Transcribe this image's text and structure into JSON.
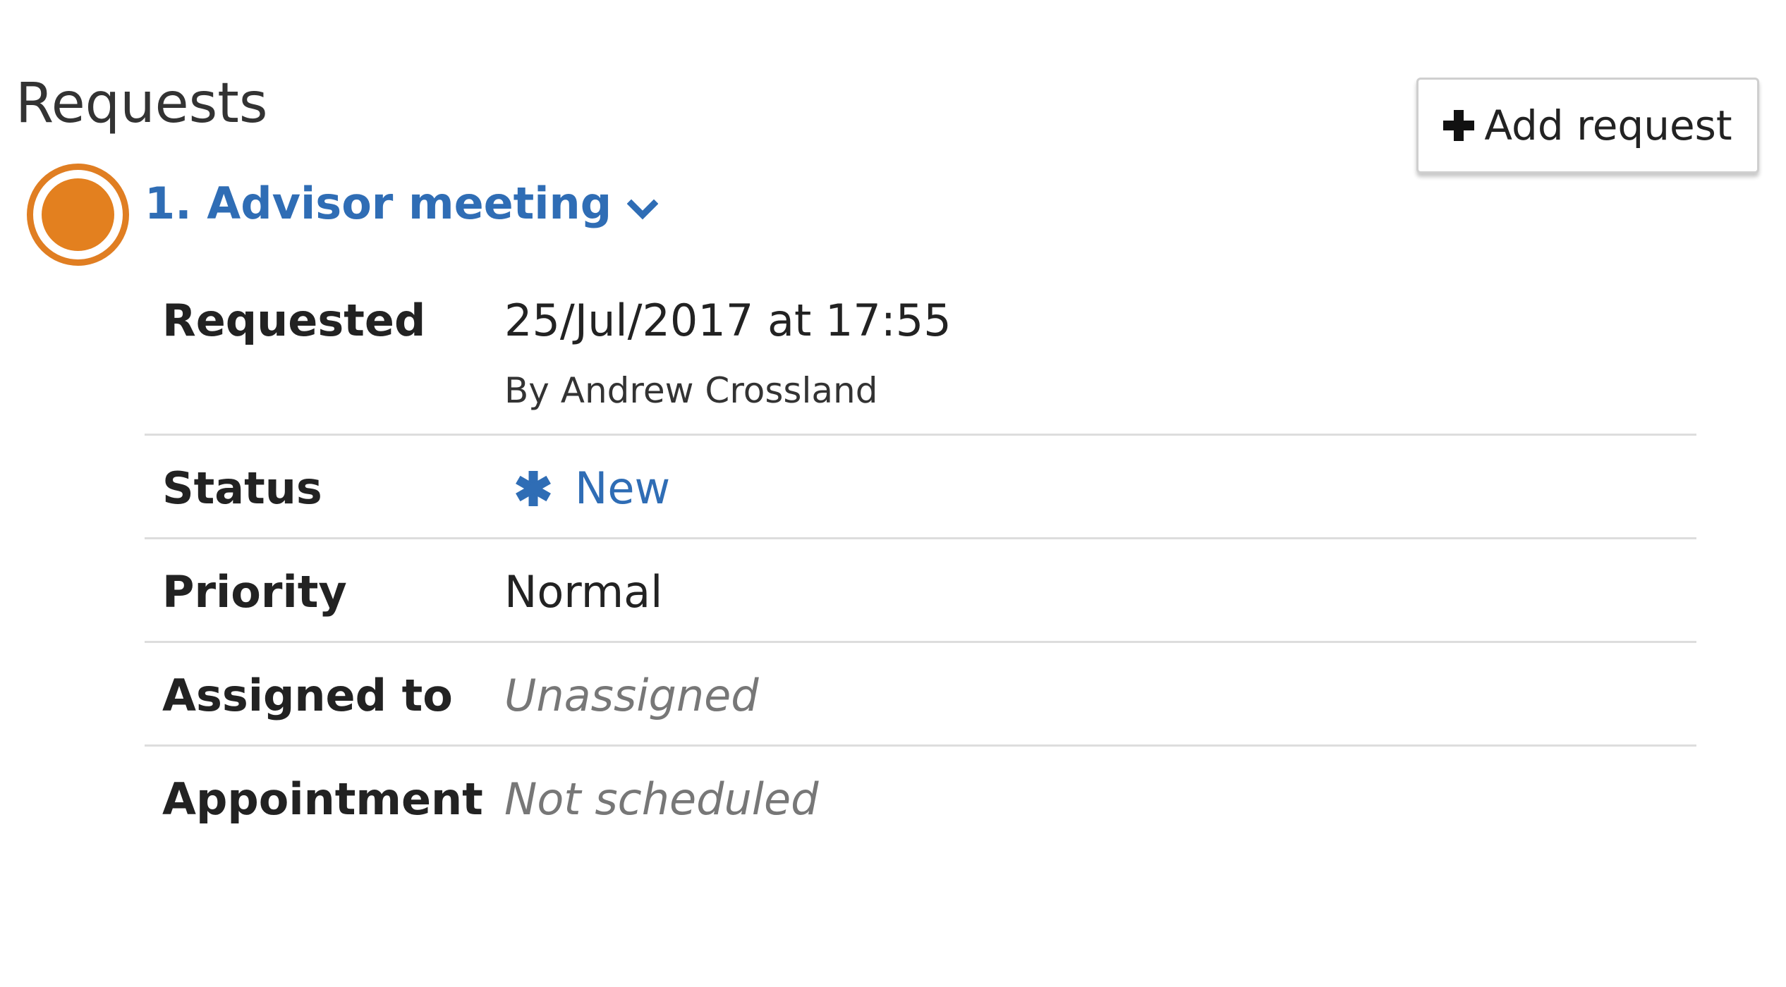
{
  "page": {
    "title": "Requests"
  },
  "toolbar": {
    "add_request_label": "Add request",
    "add_icon": "plus-icon"
  },
  "request": {
    "indicator_color": "#e3801f",
    "heading": "1. Advisor meeting",
    "expand_icon": "chevron-down-icon",
    "fields": {
      "requested": {
        "label": "Requested",
        "value": "25/Jul/2017 at 17:55",
        "by": "By Andrew Crossland"
      },
      "status": {
        "label": "Status",
        "value": "New",
        "icon": "asterisk-icon",
        "color": "#2f6db5"
      },
      "priority": {
        "label": "Priority",
        "value": "Normal"
      },
      "assigned_to": {
        "label": "Assigned to",
        "value": "Unassigned"
      },
      "appointment": {
        "label": "Appointment",
        "value": "Not scheduled"
      }
    }
  }
}
